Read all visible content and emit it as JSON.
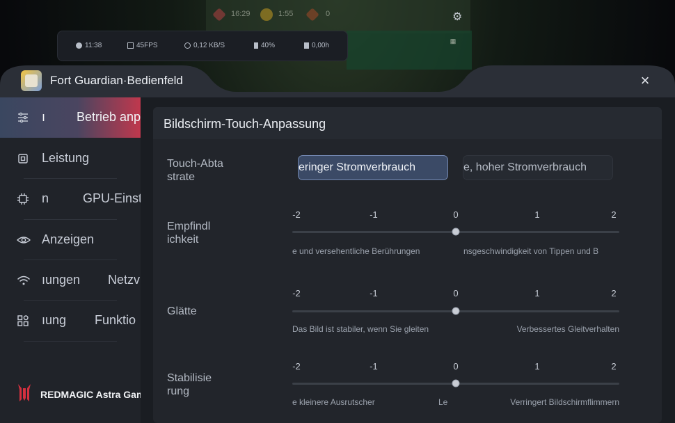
{
  "background": {
    "resources": [
      "16:29",
      "1:55",
      "0"
    ],
    "perf": {
      "clock": "11:38",
      "fps": "45FPS",
      "network": "0,12 KB/S",
      "battery": "40%",
      "duration": "0,00h"
    }
  },
  "panel": {
    "title": "Fort Guardian·Bedienfeld",
    "close_icon": "×"
  },
  "sidebar": {
    "items": [
      {
        "icon": "sliders-icon",
        "label_left": "ı",
        "label_right": "Betrieb anp",
        "active": true
      },
      {
        "icon": "chip-icon",
        "label_left": "Leistung",
        "label_right": "",
        "active": false
      },
      {
        "icon": "gpu-icon",
        "label_left": "n",
        "label_right": "GPU-Einst",
        "active": false
      },
      {
        "icon": "eye-icon",
        "label_left": "Anzeigen",
        "label_right": "",
        "active": false
      },
      {
        "icon": "wifi-icon",
        "label_left": "ıungen",
        "label_right": "Netzv",
        "active": false
      },
      {
        "icon": "apps-icon",
        "label_left": "ıung",
        "label_right": "Funktio",
        "active": false
      }
    ],
    "brand": "REDMAGIC Astra Gaming Tablet"
  },
  "card": {
    "title": "Bildschirm-Touch-Anpassung",
    "touch_rate": {
      "label": "Touch-Abta\nstrate",
      "options": [
        "eringer Stromverbrauch",
        "e, hoher Stromverbrauch"
      ],
      "selected": 0
    },
    "sliders": [
      {
        "label": "Empfindl\nichkeit",
        "ticks": [
          "-2",
          "-1",
          "0",
          "1",
          "2"
        ],
        "value": 0,
        "hint_left": "e und versehentliche  Berührungen",
        "hint_right": "nsgeschwindigkeit  von Tippen und B"
      },
      {
        "label": "Glätte",
        "ticks": [
          "-2",
          "-1",
          "0",
          "1",
          "2"
        ],
        "value": 0,
        "hint_left": "Das Bild ist stabiler, wenn Sie gleiten",
        "hint_right": "Verbessertes Gleitverhalten"
      },
      {
        "label": "Stabilisie\nrung",
        "ticks": [
          "-2",
          "-1",
          "0",
          "1",
          "2"
        ],
        "value": 0,
        "hint_left": "e kleinere Ausrutscher",
        "hint_mid": "Le",
        "hint_right": "Verringert Bildschirmflimmern"
      }
    ]
  }
}
